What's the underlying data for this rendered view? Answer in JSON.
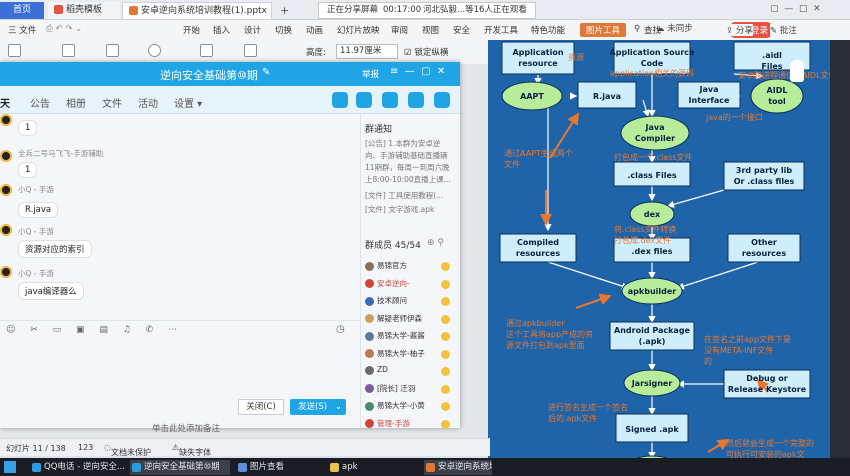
{
  "tabs": {
    "home": "首页",
    "stay": "稻壳模板",
    "doc": "安卓逆向系统培训教程(1).pptx"
  },
  "share": {
    "status": "正在分享屏幕",
    "time": "00:17:00",
    "viewers": "河北弘毅...等16人正在观看"
  },
  "menu": {
    "file": "三 文件",
    "items": [
      "开始",
      "插入",
      "设计",
      "切换",
      "动画",
      "幻灯片放映",
      "审阅",
      "视图",
      "安全",
      "开发工具",
      "特色功能"
    ],
    "picture_tools": "图片工具",
    "search": "查找",
    "visitor": "访客登录",
    "cloud": "未同步",
    "share": "分享",
    "annotate": "批注"
  },
  "toolbar": {
    "height_label": "高度:",
    "height_value": "11.97厘米",
    "lock_ratio": "锁定纵横"
  },
  "qq": {
    "title": "逆向安全基础第⑩期",
    "report": "举报",
    "tabs": [
      "天",
      "公告",
      "相册",
      "文件",
      "活动",
      "设置 ▾"
    ],
    "messages": [
      {
        "type": "bubble",
        "text": "1"
      },
      {
        "type": "name",
        "text": "全兵二号马飞飞-手游辅助"
      },
      {
        "type": "bubble",
        "text": "1"
      },
      {
        "type": "name",
        "text": "小Q - 手游"
      },
      {
        "type": "bubble",
        "text": "R.java"
      },
      {
        "type": "name",
        "text": "小Q - 手游"
      },
      {
        "type": "bubble",
        "text": "资源对应的索引"
      },
      {
        "type": "name",
        "text": "小Q - 手游"
      },
      {
        "type": "bubble",
        "text": "java编译器么"
      }
    ],
    "notice_title": "群通知",
    "notices": [
      "[公告] 1.本群为安卓逆",
      "向、手游辅助基础直播辆",
      "11期群，每周一到周六晚",
      "上8:00-10:00直播上课...",
      "[文件] 工具使用教程(...",
      "[文件] 文字游戏.apk"
    ],
    "members_title": "群成员 45/54",
    "members": [
      "易锦官方",
      "安卓逆向-",
      "技术顾问",
      "解疑老师伊森",
      "易锦大学-酱酱",
      "易锦大学-柚子",
      "ZD",
      "[院长] 迁羽",
      "易锦大学-小黄",
      "管理-手游"
    ],
    "close_btn": "关闭(C)",
    "send_btn": "发送(S)"
  },
  "slide": {
    "boxes": [
      "Application resource",
      "Application Source Code",
      ".aidl Files",
      "R.java",
      "Java Interface",
      ".class Files",
      "3rd party lib Or .class files",
      "Compiled resources",
      ".dex files",
      "Other resources",
      "Android Package (.apk)",
      "Debug or Release Keystore",
      "Signed .apk"
    ],
    "ovals": [
      "AAPT",
      "Java Compiler",
      "AIDL tool",
      "dex",
      "apkbuilder",
      "Jarsigner",
      "zipalign"
    ],
    "notes": [
      "资源",
      "application相关的源码",
      "安卓跨进程通信的AIDL文件",
      "java的一个接口",
      "通过AAPT生成两个文件",
      "打包成一个.class文件",
      "将.class文件转换打包成.dex文件",
      "通过apkbuilder这个工具将app产成的资源文件打包到apk里面",
      "在签名之前app文件下是没有META-INF文件的",
      "进行签名生成一个签名后的.apk文件",
      "然后就会生成一个完整的可执行可安装的apk文件",
      "进行对其处理"
    ]
  },
  "status": {
    "slide": "幻灯片 11 / 138",
    "num": "123",
    "protect": "文档未保护",
    "font": "缺失字体",
    "note": "单击此处添加备注"
  },
  "taskbar": [
    "QQ电话 - 逆向安全...",
    "逆向安全基础第⑩期",
    "图片查看",
    "apk",
    "安卓逆向系统培..."
  ]
}
